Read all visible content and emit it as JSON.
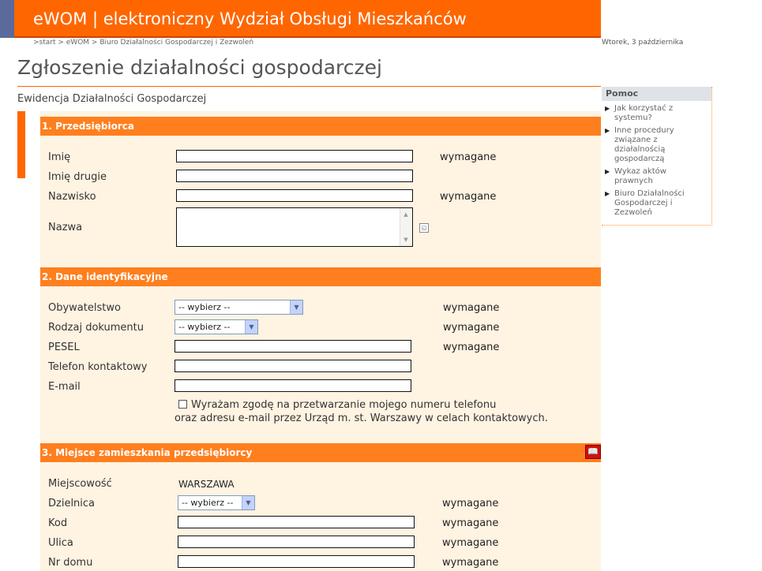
{
  "header": {
    "title": "eWOM | elektroniczny Wydział Obsługi Mieszkańców",
    "breadcrumb": ">start > eWOM > Biuro Działalności Gospodarczej i Zezwoleń",
    "date": "Wtorek, 3 października"
  },
  "page": {
    "title": "Zgłoszenie działalności gospodarczej",
    "subtitle": "Ewidencja Działalności Gospodarczej"
  },
  "required_label": "wymagane",
  "section1": {
    "header": "1. Przedsiębiorca",
    "imie": "Imię",
    "imie_drugie": "Imię drugie",
    "nazwisko": "Nazwisko",
    "nazwa": "Nazwa"
  },
  "section2": {
    "header": "2. Dane identyfikacyjne",
    "obywatelstwo": "Obywatelstwo",
    "obywatelstwo_value": "-- wybierz --",
    "rodzaj_dokumentu": "Rodzaj dokumentu",
    "rodzaj_dokumentu_value": "-- wybierz --",
    "pesel": "PESEL",
    "telefon": "Telefon kontaktowy",
    "email": "E-mail",
    "consent_line1": "Wyrażam zgodę na przetwarzanie mojego numeru telefonu",
    "consent_line2": "oraz adresu e-mail przez Urząd m. st. Warszawy w celach kontaktowych."
  },
  "section3": {
    "header": "3. Miejsce zamieszkania przedsiębiorcy",
    "miejscowosc": "Miejscowość",
    "miejscowosc_value": "WARSZAWA",
    "dzielnica": "Dzielnica",
    "dzielnica_value": "-- wybierz --",
    "kod": "Kod",
    "ulica": "Ulica",
    "nr_domu": "Nr domu"
  },
  "help": {
    "title": "Pomoc",
    "items": [
      "Jak korzystać z systemu?",
      "Inne procedury związane z działalnością gospodarczą",
      "Wykaz aktów prawnych",
      "Biuro Działalności Gospodarczej i Zezwoleń"
    ]
  }
}
